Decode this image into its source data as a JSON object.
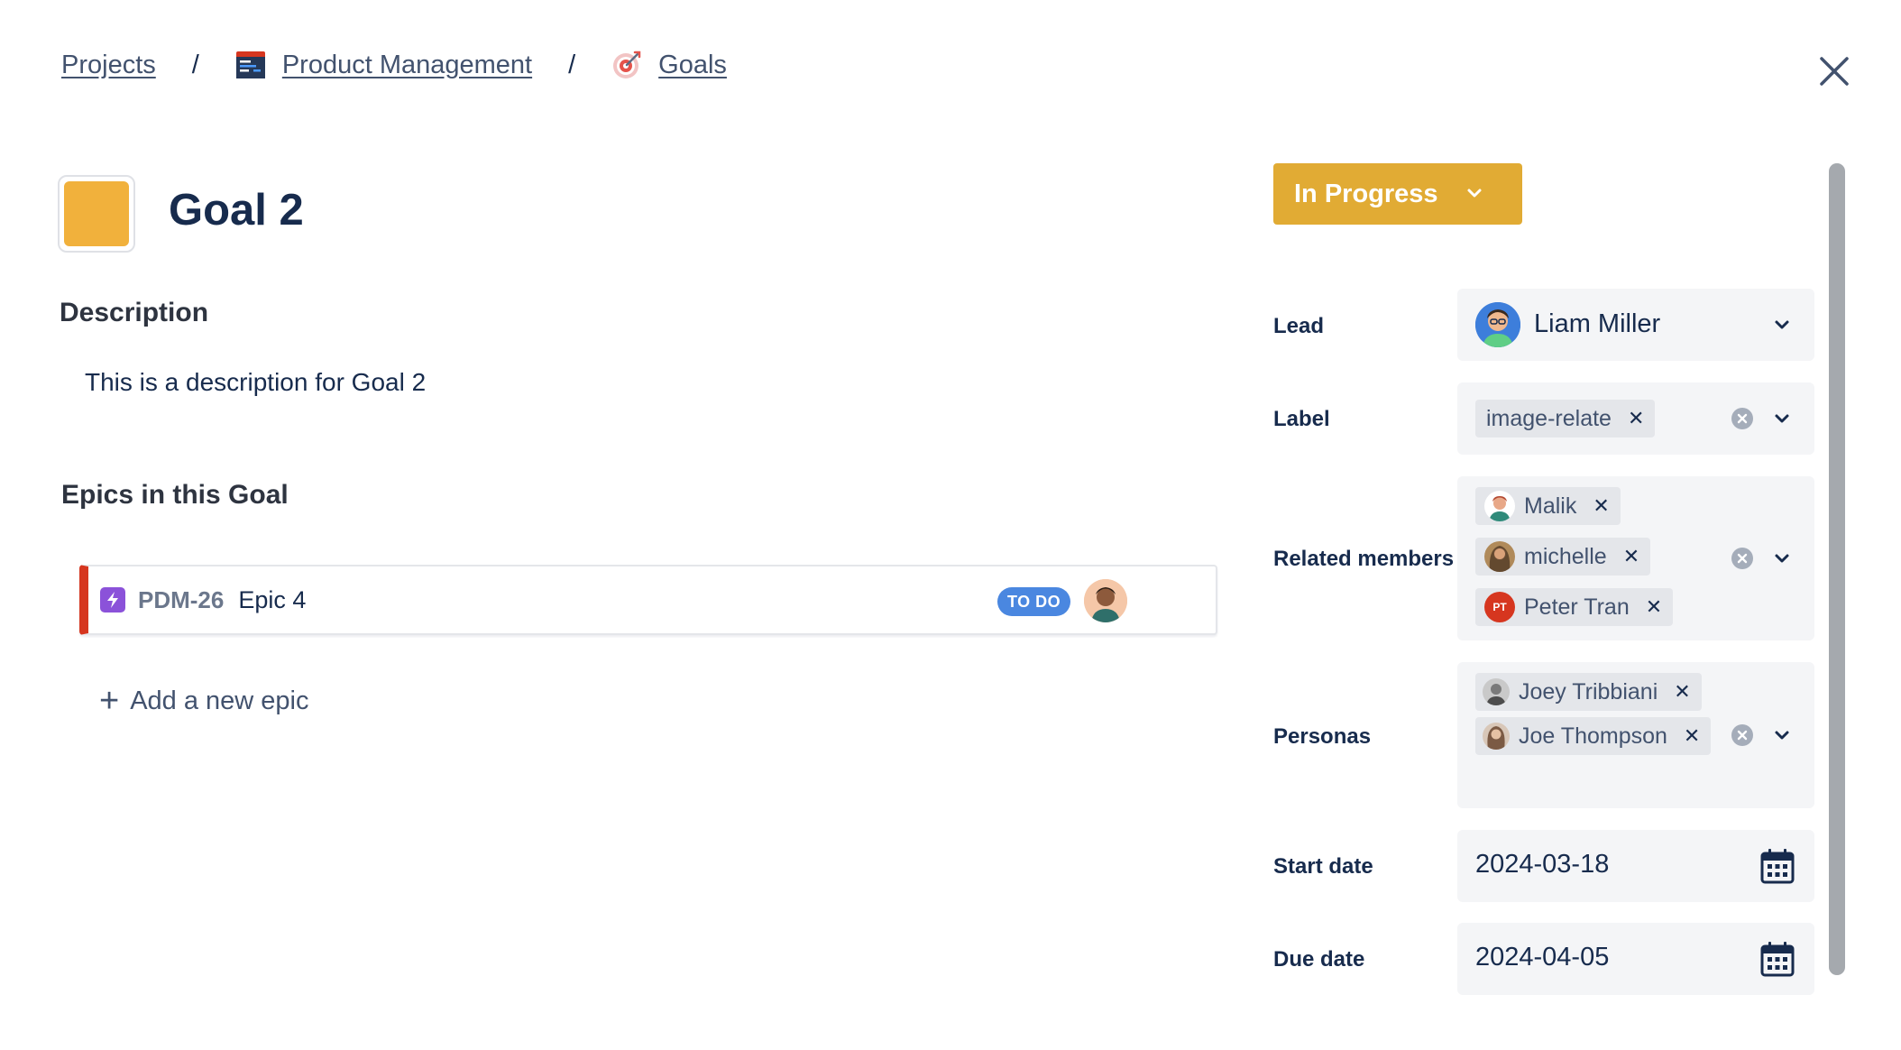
{
  "breadcrumb": {
    "projects": "Projects",
    "separator": "/",
    "project": "Product Management",
    "page": "Goals"
  },
  "goal": {
    "title": "Goal 2",
    "color": "#f1b13c"
  },
  "description": {
    "heading": "Description",
    "text": "This is a description for Goal 2"
  },
  "epics": {
    "heading": "Epics in this Goal",
    "items": [
      {
        "key": "PDM-26",
        "name": "Epic 4",
        "status": "TO DO"
      }
    ],
    "add_label": "Add a new epic"
  },
  "status": {
    "label": "In Progress",
    "color": "#e1ab34"
  },
  "fields": {
    "lead": {
      "label": "Lead",
      "value": "Liam Miller"
    },
    "label": {
      "label": "Label",
      "tags": [
        "image-relate"
      ]
    },
    "related_members": {
      "label": "Related members",
      "members": [
        {
          "name": "Malik"
        },
        {
          "name": "michelle"
        },
        {
          "name": "Peter Tran",
          "initials": "PT"
        }
      ]
    },
    "personas": {
      "label": "Personas",
      "items": [
        {
          "name": "Joey Tribbiani"
        },
        {
          "name": "Joe Thompson"
        }
      ]
    },
    "start_date": {
      "label": "Start date",
      "value": "2024-03-18"
    },
    "due_date": {
      "label": "Due date",
      "value": "2024-04-05"
    }
  },
  "icons": {
    "close": "close-icon",
    "chevron": "chevron-down-icon",
    "clear": "clear-icon",
    "calendar": "calendar-icon"
  }
}
